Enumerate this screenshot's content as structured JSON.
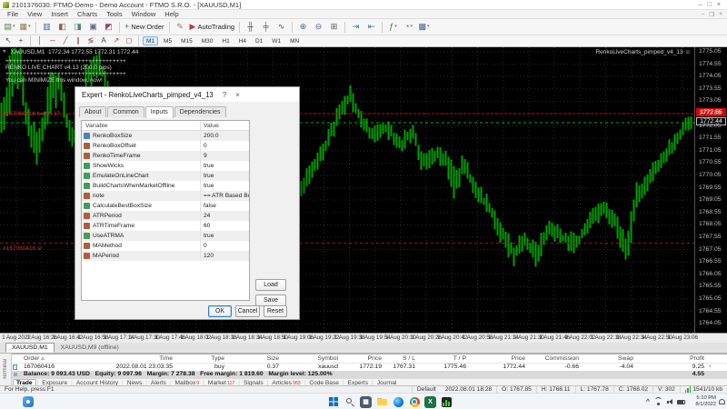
{
  "window": {
    "title": "2101376030: FTMO-Demo - Demo Account - FTMO S.R.O. - [XAUUSD,M1]",
    "controls": {
      "minimize": "–",
      "maximize": "□",
      "close": "×"
    }
  },
  "menu": {
    "items": [
      "File",
      "View",
      "Insert",
      "Charts",
      "Tools",
      "Window",
      "Help"
    ]
  },
  "toolbars": {
    "main": [
      {
        "n": "new-chart-icon",
        "g": "▤",
        "c": "#4a7d46",
        "dd": true
      },
      {
        "n": "profiles-icon",
        "g": "▦",
        "c": "#8a7a4a",
        "dd": true
      },
      {
        "sep": true
      },
      {
        "n": "market-watch-icon",
        "g": "▥",
        "c": "#46628a"
      },
      {
        "n": "data-window-icon",
        "g": "◧",
        "c": "#8a6246"
      },
      {
        "n": "navigator-icon",
        "g": "◨",
        "c": "#468a72"
      },
      {
        "n": "terminal-panel-icon",
        "g": "▣",
        "c": "#62628a"
      },
      {
        "n": "strategy-tester-icon",
        "g": "◩",
        "c": "#8a4662"
      },
      {
        "sep": true
      },
      {
        "n": "new-order-button",
        "g": "+",
        "c": "#2f7d2f",
        "label": "New Order"
      },
      {
        "sep": true
      },
      {
        "n": "metaeditor-icon",
        "g": "✎",
        "c": "#8a8a46"
      },
      {
        "n": "autotrading-button",
        "g": "▶",
        "c": "#c43a3a",
        "label": "AutoTrading"
      },
      {
        "sep": true
      },
      {
        "n": "bar-chart-icon",
        "g": "╫",
        "c": "#555555"
      },
      {
        "n": "candlestick-icon",
        "g": "╪",
        "c": "#555555"
      },
      {
        "n": "line-chart-icon",
        "g": "∿",
        "c": "#555555"
      },
      {
        "sep": true
      },
      {
        "n": "zoom-in-icon",
        "g": "⊕",
        "c": "#46628a"
      },
      {
        "n": "zoom-out-icon",
        "g": "⊖",
        "c": "#46628a"
      },
      {
        "n": "tile-windows-icon",
        "g": "⊞",
        "c": "#555555"
      },
      {
        "sep": true
      },
      {
        "n": "auto-scroll-icon",
        "g": "⇥",
        "c": "#3a6ea5"
      },
      {
        "n": "chart-shift-icon",
        "g": "⇤",
        "c": "#3a6ea5"
      },
      {
        "sep": true
      },
      {
        "n": "indicators-icon",
        "g": "ƒ",
        "c": "#2f7d2f",
        "dd": true
      },
      {
        "n": "periods-icon",
        "g": "◔",
        "c": "#8a6246",
        "dd": true
      },
      {
        "n": "templates-icon",
        "g": "▩",
        "c": "#46628a",
        "dd": true
      }
    ],
    "drawing": [
      {
        "n": "cursor-icon",
        "g": "↖",
        "c": "#444444"
      },
      {
        "n": "crosshair-icon",
        "g": "+",
        "c": "#444444"
      },
      {
        "sep": true
      },
      {
        "n": "vertical-line-icon",
        "g": "│",
        "c": "#8a4646"
      },
      {
        "n": "horizontal-line-icon",
        "g": "─",
        "c": "#8a4646"
      },
      {
        "n": "trendline-icon",
        "g": "╱",
        "c": "#8a4646"
      },
      {
        "n": "channel-icon",
        "g": "∥",
        "c": "#8a4646"
      },
      {
        "n": "fibonacci-icon",
        "g": "≶",
        "c": "#8a4646"
      },
      {
        "n": "text-icon",
        "g": "A",
        "c": "#444444"
      },
      {
        "n": "arrow-object-icon",
        "g": "↗",
        "c": "#8a4646"
      },
      {
        "n": "shapes-icon",
        "g": "◻",
        "c": "#8a4646"
      },
      {
        "sep": true
      }
    ],
    "timeframes": [
      "M1",
      "M5",
      "M15",
      "M30",
      "H1",
      "H4",
      "D1",
      "W1",
      "MN"
    ],
    "active_timeframe": "M1"
  },
  "chart": {
    "collapse_arrow": "▼",
    "symbol_ohlc": "XAUUSD,M1  1772.34 1772.55 1772.31 1772.44",
    "ea_label": "RenkoLiveCharts_pimped_v4_13 ☺",
    "overlay_lines": [
      "+++++++++++++++++++++++++++++++++++",
      "RENKO LIVE CHART v4.13 (200.0 pips)",
      "+++++++++++++++++++++++++++++++++++",
      "You can MINIMIZE this window, now!"
    ],
    "order_line_label": "#167060416 buy 0.37",
    "sl_line_label": "#167060416 sl",
    "bid_label": "1772.55",
    "ask_label": "1772.44",
    "levels": {
      "bid": 1772.55,
      "open": 1772.19,
      "sl": 1767.31
    },
    "price_ticks": [
      "1775.05",
      "1774.55",
      "1774.05",
      "1773.55",
      "1773.05",
      "1772.55",
      "1772.05",
      "1771.55",
      "1771.05",
      "1770.55",
      "1770.05",
      "1769.55",
      "1769.05",
      "1768.55",
      "1768.05",
      "1767.55",
      "1767.05",
      "1766.55",
      "1766.05",
      "1765.55",
      "1765.05",
      "1764.55",
      "1764.05"
    ],
    "time_ticks": [
      "1 Aug 2022",
      "1 Aug 16:26",
      "1 Aug 16:42",
      "1 Aug 16:58",
      "1 Aug 17:14",
      "1 Aug 17:30",
      "1 Aug 17:46",
      "1 Aug 18:02",
      "1 Aug 18:18",
      "1 Aug 18:34",
      "1 Aug 18:50",
      "1 Aug 19:06",
      "1 Aug 19:22",
      "1 Aug 19:38",
      "1 Aug 19:54",
      "1 Aug 20:10",
      "1 Aug 20:26",
      "1 Aug 20:42",
      "1 Aug 20:58",
      "1 Aug 21:14",
      "1 Aug 21:30",
      "1 Aug 21:46",
      "1 Aug 22:02",
      "1 Aug 22:18",
      "1 Aug 22:34",
      "1 Aug 22:50",
      "1 Aug 23:06"
    ],
    "price_path": [
      [
        0,
        1771.8,
        0.9
      ],
      [
        8,
        1773.2,
        1.4
      ],
      [
        14,
        1774.3,
        1.1
      ],
      [
        22,
        1774.6,
        1.2
      ],
      [
        30,
        1772.2,
        0.9
      ],
      [
        40,
        1771.2,
        0.8
      ],
      [
        50,
        1772.4,
        0.9
      ],
      [
        58,
        1773.6,
        1.2
      ],
      [
        66,
        1773.9,
        1.0
      ],
      [
        74,
        1772.2,
        0.8
      ],
      [
        82,
        1771.6,
        0.7
      ],
      [
        95,
        1773.9,
        0.9
      ],
      [
        104,
        1774.6,
        0.8
      ],
      [
        112,
        1774.3,
        0.7
      ],
      [
        122,
        1773.1,
        0.6
      ],
      [
        135,
        1771.5,
        0.5
      ],
      [
        180,
        1770.5,
        0.5
      ],
      [
        230,
        1769.5,
        0.5
      ],
      [
        290,
        1769.2,
        0.5
      ],
      [
        330,
        1769.5,
        0.45
      ],
      [
        345,
        1770.3,
        0.45
      ],
      [
        360,
        1771.4,
        0.45
      ],
      [
        375,
        1772.7,
        0.5
      ],
      [
        385,
        1773.3,
        0.5
      ],
      [
        395,
        1772.5,
        0.45
      ],
      [
        410,
        1771.7,
        0.4
      ],
      [
        425,
        1772.0,
        0.4
      ],
      [
        440,
        1771.3,
        0.4
      ],
      [
        455,
        1771.8,
        0.4
      ],
      [
        465,
        1770.5,
        0.45
      ],
      [
        480,
        1770.9,
        0.4
      ],
      [
        492,
        1770.6,
        0.5
      ],
      [
        500,
        1769.6,
        0.8
      ],
      [
        510,
        1770.5,
        0.45
      ],
      [
        525,
        1769.4,
        0.45
      ],
      [
        540,
        1768.6,
        0.5
      ],
      [
        555,
        1767.5,
        0.5
      ],
      [
        565,
        1766.9,
        0.55
      ],
      [
        578,
        1767.4,
        0.45
      ],
      [
        590,
        1766.8,
        0.55
      ],
      [
        605,
        1768.0,
        0.5
      ],
      [
        620,
        1767.5,
        0.45
      ],
      [
        635,
        1767.3,
        0.45
      ],
      [
        650,
        1768.3,
        0.45
      ],
      [
        665,
        1768.7,
        0.4
      ],
      [
        678,
        1768.2,
        0.5
      ],
      [
        690,
        1766.9,
        0.9
      ],
      [
        700,
        1769.2,
        0.6
      ],
      [
        715,
        1770.0,
        0.45
      ],
      [
        728,
        1770.7,
        0.4
      ],
      [
        740,
        1771.3,
        0.4
      ],
      [
        752,
        1771.9,
        0.4
      ],
      [
        763,
        1772.4,
        0.4
      ]
    ],
    "colors": {
      "candle": "#00a000",
      "grid": "#2e2e2e",
      "bid_line": "#dd0000",
      "open_line": "#00b300",
      "sl_line": "#cc0000",
      "label_red": "#c0392b"
    }
  },
  "chart_tabs": {
    "tabs": [
      "XAUUSD,M1",
      "XAUUSD,M9 (offline)"
    ],
    "active": 0
  },
  "terminal": {
    "caption": "Terminal",
    "columns": [
      "Order",
      "Time",
      "Type",
      "Size",
      "Symbol",
      "Price",
      "S / L",
      "T / P",
      "Price",
      "Commission",
      "Swap",
      "Profit"
    ],
    "order": {
      "id": "167060416",
      "time": "2022.08.01 23:03:35",
      "type": "buy",
      "size": "0.37",
      "symbol": "xauusd",
      "open_price": "1772.19",
      "sl": "1767.31",
      "tp": "1775.46",
      "price": "1772.44",
      "commission": "-0.66",
      "swap": "-4.04",
      "profit": "9.25",
      "close": "×"
    },
    "balance_line": "Balance: 9 093.43 USD   Equity: 9 097.98   Margin: 7 278.38   Free margin: 1 819.60   Margin level: 125.00%",
    "total_profit": "4.55",
    "tabs": [
      {
        "label": "Trade",
        "active": true
      },
      {
        "label": "Exposure"
      },
      {
        "label": "Account History"
      },
      {
        "label": "News"
      },
      {
        "label": "Alerts"
      },
      {
        "label": "Mailbox",
        "badge": "9"
      },
      {
        "label": "Market",
        "badge": "117"
      },
      {
        "label": "Signals"
      },
      {
        "label": "Articles",
        "badge": "983"
      },
      {
        "label": "Code Base"
      },
      {
        "label": "Experts"
      },
      {
        "label": "Journal"
      }
    ]
  },
  "status_bar": {
    "help": "For Help, press F1",
    "profile": "Default",
    "segments": [
      "2022.08.01 18:28",
      "O: 1767.85",
      "H: 1768.11",
      "L: 1767.78",
      "C: 1768.02",
      "V: 302"
    ],
    "traffic": "1541/10 kb"
  },
  "taskbar": {
    "icons": [
      {
        "name": "start",
        "kind": "windows"
      },
      {
        "name": "search",
        "kind": "search"
      },
      {
        "name": "task-view",
        "kind": "square",
        "color": "#4a5b6e",
        "glyph": "▦"
      },
      {
        "name": "file-explorer",
        "kind": "folder"
      },
      {
        "name": "edge",
        "kind": "edge"
      },
      {
        "name": "chrome",
        "kind": "chrome"
      },
      {
        "name": "excel",
        "kind": "square",
        "color": "#1e7145",
        "glyph": "X"
      },
      {
        "name": "metatrader",
        "kind": "mt"
      }
    ],
    "clock": {
      "time": "5:10 PM",
      "date": "8/1/2022"
    }
  },
  "dialog": {
    "title": "Expert - RenkoLiveCharts_pimped_v4_13",
    "help_button": "?",
    "close_button": "×",
    "tabs": [
      "About",
      "Common",
      "Inputs",
      "Dependencies"
    ],
    "active_tab": 2,
    "table": {
      "headers": [
        "Variable",
        "Value"
      ],
      "rows": [
        {
          "type": "double",
          "name": "RenkoBoxSize",
          "value": "200.0"
        },
        {
          "type": "int",
          "name": "RenkoBoxOffset",
          "value": "0"
        },
        {
          "type": "int",
          "name": "RenkoTimeFrame",
          "value": "9"
        },
        {
          "type": "bool",
          "name": "ShowWicks",
          "value": "true"
        },
        {
          "type": "bool",
          "name": "EmulateOnLineChart",
          "value": "true"
        },
        {
          "type": "bool",
          "name": "BuildChartsWhenMarketOffline",
          "value": "true"
        },
        {
          "type": "string",
          "name": "note",
          "value": "== ATR Based Boxes =="
        },
        {
          "type": "bool",
          "name": "CalculateBestBoxSize",
          "value": "false"
        },
        {
          "type": "int",
          "name": "ATRPeriod",
          "value": "24"
        },
        {
          "type": "int",
          "name": "ATRTimeFrame",
          "value": "60"
        },
        {
          "type": "bool",
          "name": "UseATRMA",
          "value": "true"
        },
        {
          "type": "int",
          "name": "MAMethod",
          "value": "0"
        },
        {
          "type": "int",
          "name": "MAPeriod",
          "value": "120"
        }
      ]
    },
    "buttons": {
      "load": "Load",
      "save": "Save",
      "ok": "OK",
      "cancel": "Cancel",
      "reset": "Reset"
    }
  }
}
